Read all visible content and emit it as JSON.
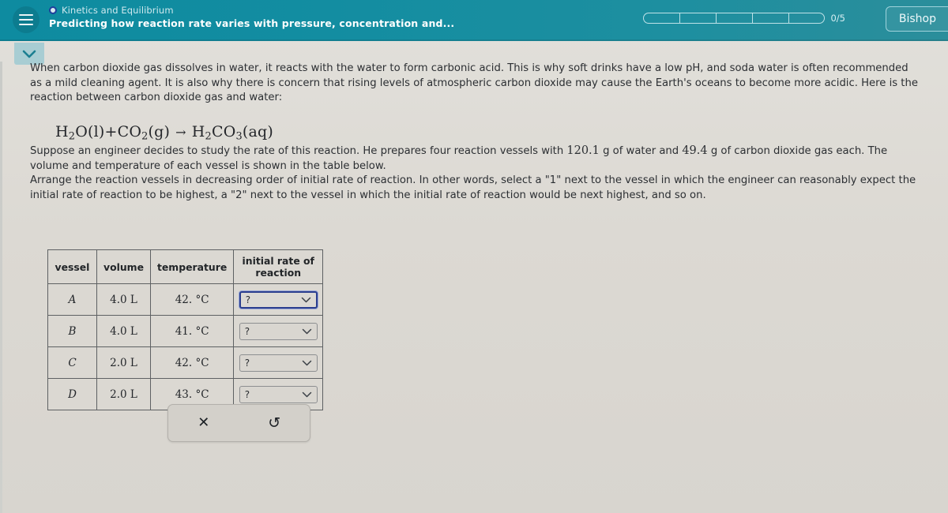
{
  "header": {
    "menu_icon": "hamburger-icon",
    "breadcrumb": "Kinetics and Equilibrium",
    "title": "Predicting how reaction rate varies with pressure, concentration and...",
    "progress_label": "0/5",
    "progress_segments": 5,
    "progress_filled": 0,
    "user_button": "Bishop",
    "teal": "#128da1"
  },
  "sidebar": {
    "collapse_tab_icon": "chevron-down-icon"
  },
  "body": {
    "paragraph1": "When carbon dioxide gas dissolves in water, it reacts with the water to form carbonic acid. This is why soft drinks have a low pH, and soda water is often recommended as a mild cleaning agent. It is also why there is concern that rising levels of atmospheric carbon dioxide may cause the Earth's oceans to become more acidic. Here is the reaction between carbon dioxide gas and water:",
    "equation": {
      "reactant1": "H2O(l)",
      "plus": "+",
      "reactant2": "CO2(g)",
      "arrow": "→",
      "product": "H2CO3(aq)",
      "display": "H2O(l)+CO2(g) → H2CO3(aq)"
    },
    "paragraph2_a": "Suppose an engineer decides to study the rate of this reaction. He prepares four reaction vessels with ",
    "water_mass": "120.1",
    "paragraph2_b": " g of water and ",
    "co2_mass": "49.4",
    "paragraph2_c": " g of carbon dioxide gas each. The volume and temperature of each vessel is shown in the table below.",
    "paragraph3": "Arrange the reaction vessels in decreasing order of initial rate of reaction. In other words, select a \"1\" next to the vessel in which the engineer can reasonably expect the initial rate of reaction to be highest, a \"2\" next to the vessel in which the initial rate of reaction would be next highest, and so on."
  },
  "table": {
    "headers": [
      "vessel",
      "volume",
      "temperature",
      "initial rate of reaction"
    ],
    "rows": [
      {
        "vessel": "A",
        "volume": "4.0 L",
        "temperature": "42. °C",
        "rate": "?",
        "focused": true
      },
      {
        "vessel": "B",
        "volume": "4.0 L",
        "temperature": "41. °C",
        "rate": "?",
        "focused": false
      },
      {
        "vessel": "C",
        "volume": "2.0 L",
        "temperature": "42. °C",
        "rate": "?",
        "focused": false
      },
      {
        "vessel": "D",
        "volume": "2.0 L",
        "temperature": "43. °C",
        "rate": "?",
        "focused": false
      }
    ]
  },
  "actions": {
    "clear_icon": "✕",
    "clear_name": "close-icon",
    "reset_icon": "↺",
    "reset_name": "refresh-icon"
  }
}
